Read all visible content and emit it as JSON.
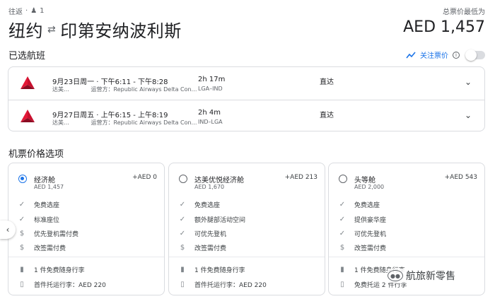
{
  "header": {
    "trip_type": "往返",
    "passengers": "1",
    "price_note": "总票价最低为",
    "origin": "纽约",
    "destination": "印第安纳波利斯",
    "total_price": "AED 1,457"
  },
  "selected_flights": {
    "title": "已选航班",
    "track_label": "关注票价",
    "track_enabled": false,
    "flights": [
      {
        "date_time": "9月23日周一 · 下午6:11 - 下午8:28",
        "airline_short": "达美…",
        "operator": "运营方：Republic Airways Delta Con…",
        "duration": "2h 17m",
        "route": "LGA–IND",
        "stops": "直达"
      },
      {
        "date_time": "9月27日周五 · 上午6:15 - 上午8:19",
        "airline_short": "达美…",
        "operator": "运营方：Republic Airways Delta Con…",
        "duration": "2h 4m",
        "route": "IND–LGA",
        "stops": "直达"
      }
    ]
  },
  "fare_options": {
    "title": "机票价格选项",
    "fares": [
      {
        "name": "经济舱",
        "price": "AED 1,457",
        "add": "+AED 0",
        "selected": true,
        "features": [
          {
            "icon": "check-icon",
            "text": "免费选座"
          },
          {
            "icon": "check-icon",
            "text": "标准座位"
          },
          {
            "icon": "dollar-icon",
            "text": "优先登机需付费"
          },
          {
            "icon": "dollar-icon",
            "text": "改签需付费"
          }
        ],
        "bags": [
          {
            "icon": "carry-on-icon",
            "text": "1 件免费随身行李"
          },
          {
            "icon": "checked-bag-paid-icon",
            "text": "首件托运行李：AED 220"
          }
        ]
      },
      {
        "name": "达美优悦经济舱",
        "price": "AED 1,670",
        "add": "+AED 213",
        "selected": false,
        "features": [
          {
            "icon": "check-icon",
            "text": "免费选座"
          },
          {
            "icon": "check-icon",
            "text": "额外腿部活动空间"
          },
          {
            "icon": "check-icon",
            "text": "可优先登机"
          },
          {
            "icon": "dollar-icon",
            "text": "改签需付费"
          }
        ],
        "bags": [
          {
            "icon": "carry-on-icon",
            "text": "1 件免费随身行李"
          },
          {
            "icon": "checked-bag-paid-icon",
            "text": "首件托运行李：AED 220"
          }
        ]
      },
      {
        "name": "头等舱",
        "price": "AED 2,000",
        "add": "+AED 543",
        "selected": false,
        "features": [
          {
            "icon": "check-icon",
            "text": "免费选座"
          },
          {
            "icon": "check-icon",
            "text": "提供豪华座"
          },
          {
            "icon": "check-icon",
            "text": "可优先登机"
          },
          {
            "icon": "dollar-icon",
            "text": "改签需付费"
          }
        ],
        "bags": [
          {
            "icon": "carry-on-icon",
            "text": "1 件免费随身行李"
          },
          {
            "icon": "checked-bag-icon",
            "text": "免费托运 2 件行李"
          }
        ]
      }
    ]
  },
  "watermark": "航旅新零售",
  "colors": {
    "accent": "#1a73e8",
    "delta_red": "#c8102e",
    "border": "#dadce0"
  }
}
